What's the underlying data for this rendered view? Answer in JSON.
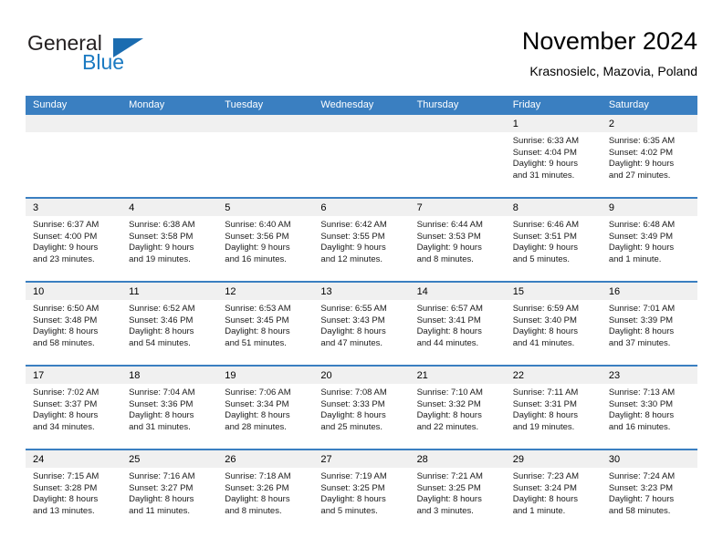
{
  "brand": {
    "name_part1": "General",
    "name_part2": "Blue",
    "accent_color": "#1b6cb0",
    "logo_icon": "triangle-flag-icon"
  },
  "header": {
    "title": "November 2024",
    "subtitle": "Krasnosielc, Mazovia, Poland"
  },
  "calendar": {
    "header_color": "#3a7fc1",
    "weekdays": [
      "Sunday",
      "Monday",
      "Tuesday",
      "Wednesday",
      "Thursday",
      "Friday",
      "Saturday"
    ],
    "weeks": [
      [
        {
          "day": "",
          "empty": true
        },
        {
          "day": "",
          "empty": true
        },
        {
          "day": "",
          "empty": true
        },
        {
          "day": "",
          "empty": true
        },
        {
          "day": "",
          "empty": true
        },
        {
          "day": "1",
          "sunrise": "Sunrise: 6:33 AM",
          "sunset": "Sunset: 4:04 PM",
          "daylight": "Daylight: 9 hours and 31 minutes."
        },
        {
          "day": "2",
          "sunrise": "Sunrise: 6:35 AM",
          "sunset": "Sunset: 4:02 PM",
          "daylight": "Daylight: 9 hours and 27 minutes."
        }
      ],
      [
        {
          "day": "3",
          "sunrise": "Sunrise: 6:37 AM",
          "sunset": "Sunset: 4:00 PM",
          "daylight": "Daylight: 9 hours and 23 minutes."
        },
        {
          "day": "4",
          "sunrise": "Sunrise: 6:38 AM",
          "sunset": "Sunset: 3:58 PM",
          "daylight": "Daylight: 9 hours and 19 minutes."
        },
        {
          "day": "5",
          "sunrise": "Sunrise: 6:40 AM",
          "sunset": "Sunset: 3:56 PM",
          "daylight": "Daylight: 9 hours and 16 minutes."
        },
        {
          "day": "6",
          "sunrise": "Sunrise: 6:42 AM",
          "sunset": "Sunset: 3:55 PM",
          "daylight": "Daylight: 9 hours and 12 minutes."
        },
        {
          "day": "7",
          "sunrise": "Sunrise: 6:44 AM",
          "sunset": "Sunset: 3:53 PM",
          "daylight": "Daylight: 9 hours and 8 minutes."
        },
        {
          "day": "8",
          "sunrise": "Sunrise: 6:46 AM",
          "sunset": "Sunset: 3:51 PM",
          "daylight": "Daylight: 9 hours and 5 minutes."
        },
        {
          "day": "9",
          "sunrise": "Sunrise: 6:48 AM",
          "sunset": "Sunset: 3:49 PM",
          "daylight": "Daylight: 9 hours and 1 minute."
        }
      ],
      [
        {
          "day": "10",
          "sunrise": "Sunrise: 6:50 AM",
          "sunset": "Sunset: 3:48 PM",
          "daylight": "Daylight: 8 hours and 58 minutes."
        },
        {
          "day": "11",
          "sunrise": "Sunrise: 6:52 AM",
          "sunset": "Sunset: 3:46 PM",
          "daylight": "Daylight: 8 hours and 54 minutes."
        },
        {
          "day": "12",
          "sunrise": "Sunrise: 6:53 AM",
          "sunset": "Sunset: 3:45 PM",
          "daylight": "Daylight: 8 hours and 51 minutes."
        },
        {
          "day": "13",
          "sunrise": "Sunrise: 6:55 AM",
          "sunset": "Sunset: 3:43 PM",
          "daylight": "Daylight: 8 hours and 47 minutes."
        },
        {
          "day": "14",
          "sunrise": "Sunrise: 6:57 AM",
          "sunset": "Sunset: 3:41 PM",
          "daylight": "Daylight: 8 hours and 44 minutes."
        },
        {
          "day": "15",
          "sunrise": "Sunrise: 6:59 AM",
          "sunset": "Sunset: 3:40 PM",
          "daylight": "Daylight: 8 hours and 41 minutes."
        },
        {
          "day": "16",
          "sunrise": "Sunrise: 7:01 AM",
          "sunset": "Sunset: 3:39 PM",
          "daylight": "Daylight: 8 hours and 37 minutes."
        }
      ],
      [
        {
          "day": "17",
          "sunrise": "Sunrise: 7:02 AM",
          "sunset": "Sunset: 3:37 PM",
          "daylight": "Daylight: 8 hours and 34 minutes."
        },
        {
          "day": "18",
          "sunrise": "Sunrise: 7:04 AM",
          "sunset": "Sunset: 3:36 PM",
          "daylight": "Daylight: 8 hours and 31 minutes."
        },
        {
          "day": "19",
          "sunrise": "Sunrise: 7:06 AM",
          "sunset": "Sunset: 3:34 PM",
          "daylight": "Daylight: 8 hours and 28 minutes."
        },
        {
          "day": "20",
          "sunrise": "Sunrise: 7:08 AM",
          "sunset": "Sunset: 3:33 PM",
          "daylight": "Daylight: 8 hours and 25 minutes."
        },
        {
          "day": "21",
          "sunrise": "Sunrise: 7:10 AM",
          "sunset": "Sunset: 3:32 PM",
          "daylight": "Daylight: 8 hours and 22 minutes."
        },
        {
          "day": "22",
          "sunrise": "Sunrise: 7:11 AM",
          "sunset": "Sunset: 3:31 PM",
          "daylight": "Daylight: 8 hours and 19 minutes."
        },
        {
          "day": "23",
          "sunrise": "Sunrise: 7:13 AM",
          "sunset": "Sunset: 3:30 PM",
          "daylight": "Daylight: 8 hours and 16 minutes."
        }
      ],
      [
        {
          "day": "24",
          "sunrise": "Sunrise: 7:15 AM",
          "sunset": "Sunset: 3:28 PM",
          "daylight": "Daylight: 8 hours and 13 minutes."
        },
        {
          "day": "25",
          "sunrise": "Sunrise: 7:16 AM",
          "sunset": "Sunset: 3:27 PM",
          "daylight": "Daylight: 8 hours and 11 minutes."
        },
        {
          "day": "26",
          "sunrise": "Sunrise: 7:18 AM",
          "sunset": "Sunset: 3:26 PM",
          "daylight": "Daylight: 8 hours and 8 minutes."
        },
        {
          "day": "27",
          "sunrise": "Sunrise: 7:19 AM",
          "sunset": "Sunset: 3:25 PM",
          "daylight": "Daylight: 8 hours and 5 minutes."
        },
        {
          "day": "28",
          "sunrise": "Sunrise: 7:21 AM",
          "sunset": "Sunset: 3:25 PM",
          "daylight": "Daylight: 8 hours and 3 minutes."
        },
        {
          "day": "29",
          "sunrise": "Sunrise: 7:23 AM",
          "sunset": "Sunset: 3:24 PM",
          "daylight": "Daylight: 8 hours and 1 minute."
        },
        {
          "day": "30",
          "sunrise": "Sunrise: 7:24 AM",
          "sunset": "Sunset: 3:23 PM",
          "daylight": "Daylight: 7 hours and 58 minutes."
        }
      ]
    ]
  }
}
